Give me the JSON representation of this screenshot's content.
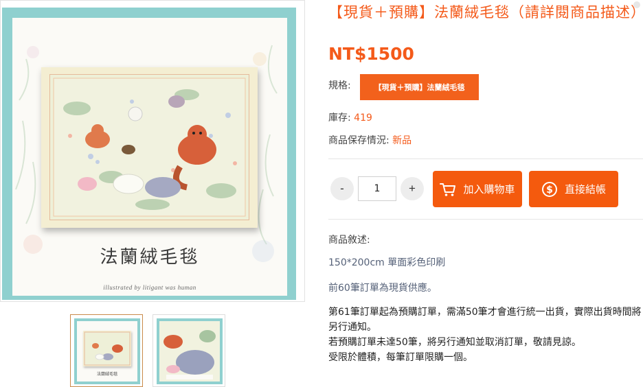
{
  "product": {
    "title": "【現貨＋預購】法蘭絨毛毯（請詳閱商品描述）",
    "price": "NT$1500"
  },
  "spec": {
    "label": "規格:",
    "option": "【現貨＋預購】法蘭絨毛毯"
  },
  "stock": {
    "label": "庫存:",
    "value": "419"
  },
  "condition": {
    "label": "商品保存情況:",
    "value": "新品"
  },
  "quantity": {
    "minus": "-",
    "value": "1",
    "plus": "+"
  },
  "buttons": {
    "add_to_cart": "加入購物車",
    "buy_now": "直接結帳"
  },
  "description": {
    "heading": "商品敘述:",
    "size": "150*200cm 單面彩色印刷",
    "stock_note": "前60筆訂單為現貨供應。",
    "notes": [
      "第61筆訂單起為預購訂單，需滿50筆才會進行統一出貨，實際出貨時間將另行通知。",
      "若預購訂單未達50筆，將另行通知並取消訂單，敬請見諒。",
      "受限於體積，每筆訂單限購一個。"
    ]
  },
  "gallery": {
    "main_caption": "法蘭絨毛毯",
    "credit": "illustrated by litigant was human",
    "thumb_caption": "法蘭絨毛毯"
  },
  "colors": {
    "accent": "#f45a1a",
    "frame": "#8fd0cf"
  }
}
